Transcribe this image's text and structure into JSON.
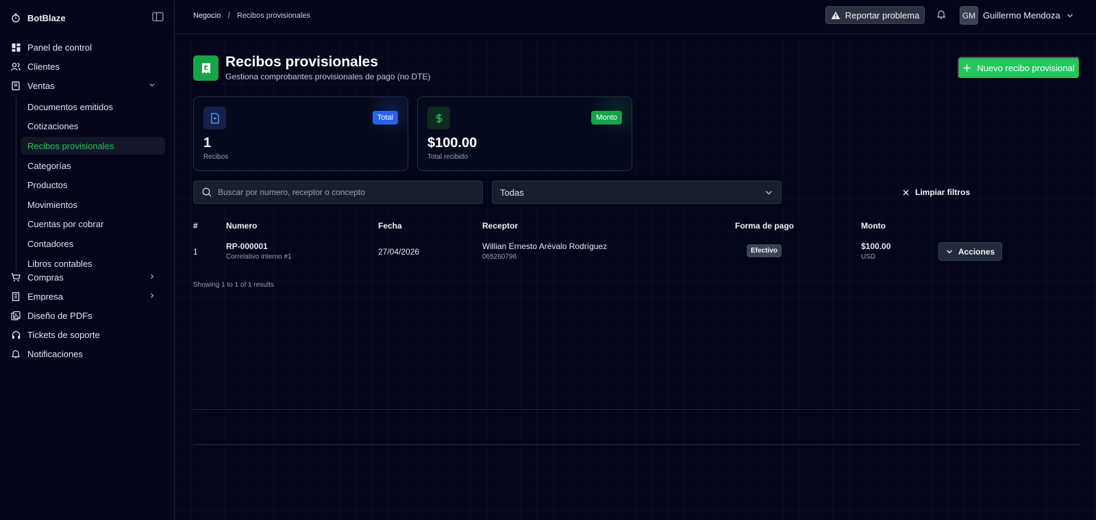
{
  "app": {
    "name": "BotBlaze"
  },
  "sidebar": {
    "items": [
      {
        "label": "Panel de control",
        "icon": "dashboard-icon"
      },
      {
        "label": "Clientes",
        "icon": "users-icon"
      },
      {
        "label": "Ventas",
        "icon": "receipt-icon",
        "expanded": true
      },
      {
        "label": "Compras",
        "icon": "cart-icon"
      },
      {
        "label": "Empresa",
        "icon": "building-icon"
      },
      {
        "label": "Diseño de PDFs",
        "icon": "pdf-icon"
      },
      {
        "label": "Tickets de soporte",
        "icon": "headset-icon"
      },
      {
        "label": "Notificaciones",
        "icon": "bell-icon"
      }
    ],
    "ventas_children": [
      "Documentos emitidos",
      "Cotizaciones",
      "Recibos provisionales",
      "Categorías",
      "Productos",
      "Movimientos",
      "Cuentas por cobrar",
      "Contadores",
      "Libros contables"
    ]
  },
  "header": {
    "breadcrumb": [
      "Negocio",
      "Recibos provisionales"
    ],
    "breadcrumb_sep": "/",
    "report_label": "Reportar problema",
    "user_initials": "GM",
    "user_name": "Guillermo Mendoza"
  },
  "page": {
    "title": "Recibos provisionales",
    "subtitle": "Gestiona comprobantes provisionales de pago (no DTE)",
    "new_button": "Nuevo recibo provisional"
  },
  "stats": [
    {
      "badge": "Total",
      "value": "1",
      "label": "Recibos",
      "color": "#2563eb"
    },
    {
      "badge": "Monto",
      "value": "$100.00",
      "label": "Total recibido",
      "color": "#16a34a"
    }
  ],
  "filters": {
    "search_placeholder": "Buscar por numero, receptor o concepto",
    "select_value": "Todas",
    "clear_label": "Limpiar filtros"
  },
  "table": {
    "columns": [
      "#",
      "Numero",
      "Fecha",
      "Receptor",
      "Forma de pago",
      "Monto"
    ],
    "rows": [
      {
        "index": "1",
        "numero": "RP-000001",
        "numero_sub": "Correlativo interno #1",
        "fecha": "27/04/2026",
        "receptor": "Willian Ernesto Arévalo Rodríguez",
        "receptor_sub": "065260796",
        "forma_pago": "Efectivo",
        "monto": "$100.00",
        "moneda": "USD",
        "actions_label": "Acciones"
      }
    ],
    "footer": "Showing 1 to 1 of 1 results"
  }
}
